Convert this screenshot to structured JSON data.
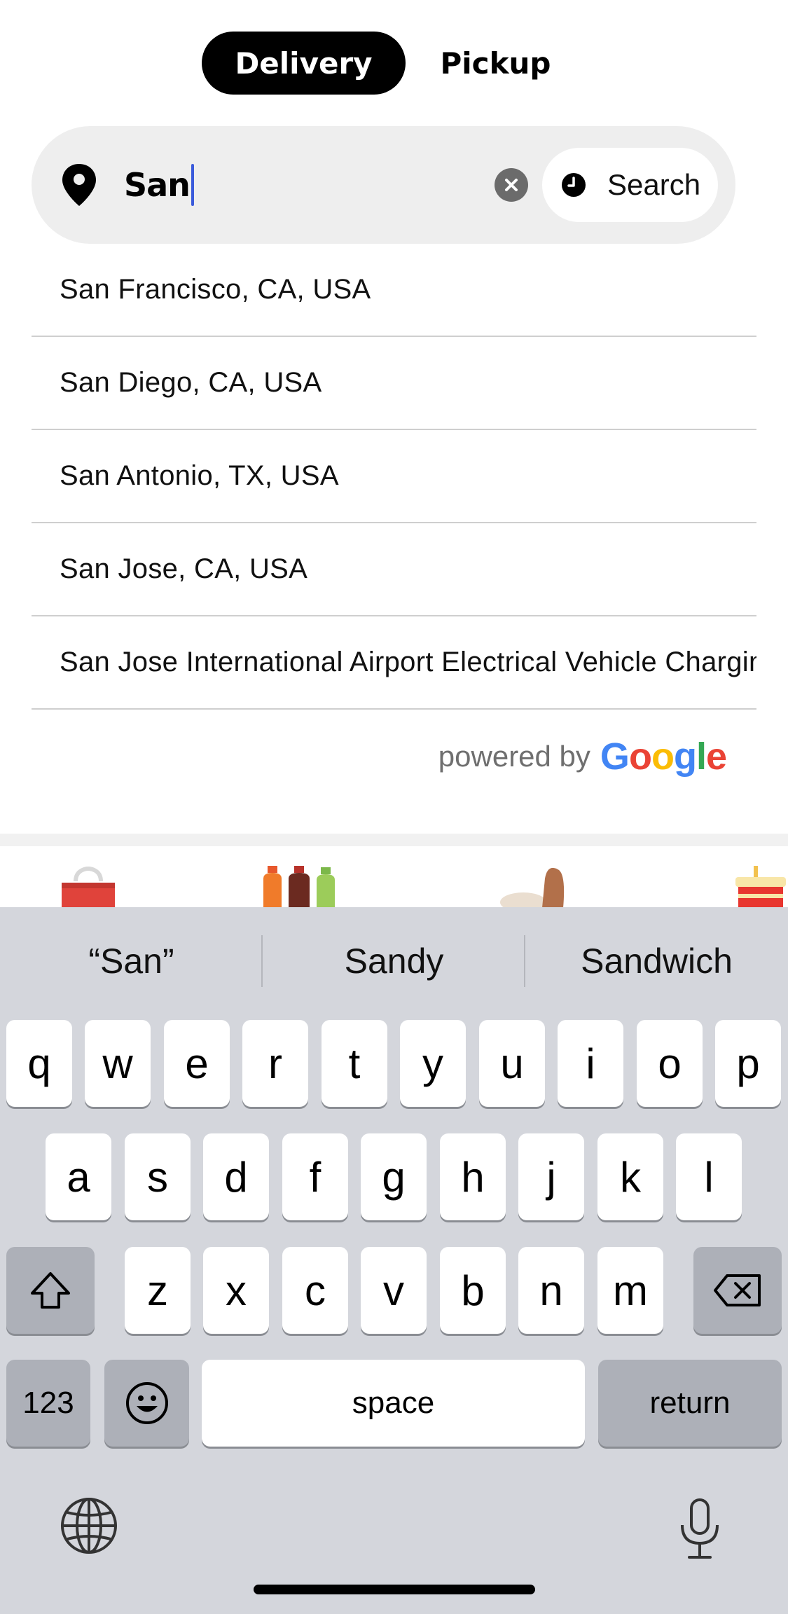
{
  "mode_toggle": {
    "delivery_label": "Delivery",
    "pickup_label": "Pickup",
    "selected": "Delivery"
  },
  "search": {
    "value": "San",
    "schedule_label": "Search"
  },
  "suggestions": [
    {
      "label": "San Francisco, CA, USA"
    },
    {
      "label": "San Diego, CA, USA"
    },
    {
      "label": "San Antonio, TX, USA"
    },
    {
      "label": "San Jose, CA, USA"
    },
    {
      "label": "San Jose International Airport Electrical Vehicle Charging Station"
    }
  ],
  "attribution": {
    "powered_by": "powered by",
    "google_letters": [
      "G",
      "o",
      "o",
      "g",
      "l",
      "e"
    ]
  },
  "categories": [
    {
      "icon": "shopping-bag-icon"
    },
    {
      "icon": "drinks-icon"
    },
    {
      "icon": "bread-icon"
    },
    {
      "icon": "fast-food-icon"
    }
  ],
  "keyboard": {
    "predictions": [
      "“San”",
      "Sandy",
      "Sandwich"
    ],
    "row1": [
      "q",
      "w",
      "e",
      "r",
      "t",
      "y",
      "u",
      "i",
      "o",
      "p"
    ],
    "row2": [
      "a",
      "s",
      "d",
      "f",
      "g",
      "h",
      "j",
      "k",
      "l"
    ],
    "row3": [
      "z",
      "x",
      "c",
      "v",
      "b",
      "n",
      "m"
    ],
    "numbers_label": "123",
    "space_label": "space",
    "return_label": "return"
  },
  "colors": {
    "accent_caret": "#3b5bdb",
    "toggle_active_bg": "#000000",
    "search_bg": "#eeeeee",
    "keyboard_bg": "#d4d6dc"
  }
}
